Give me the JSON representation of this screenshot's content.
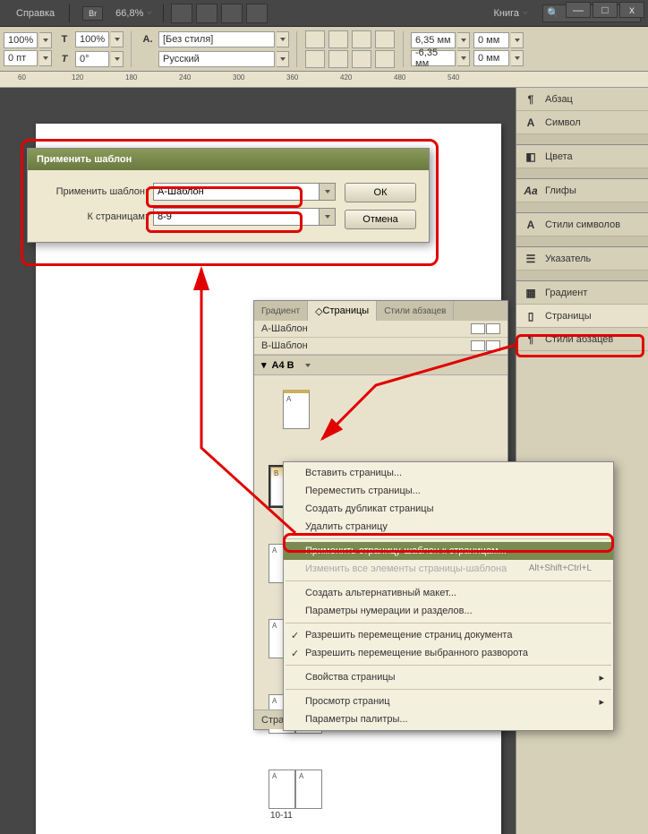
{
  "menubar": {
    "help": "Справка",
    "br_badge": "Br",
    "zoom": "66,8%",
    "book": "Книга"
  },
  "window_controls": {
    "min": "—",
    "max": "□",
    "close": "x"
  },
  "controlbar": {
    "percent1": "100%",
    "percent2": "100%",
    "leading": "0 пт",
    "t_icon": "T",
    "t_small": "T",
    "a_icon": "A.",
    "style_none": "[Без стиля]",
    "lang": "Русский",
    "rotation": "0°",
    "measure_top": "6,35 мм",
    "measure_bot": "-6,35 мм",
    "zero1": "0 мм",
    "zero2": "0 мм"
  },
  "ruler_vals": [
    "60",
    "120",
    "180",
    "240",
    "300",
    "360",
    "420",
    "480",
    "540"
  ],
  "right_panels": {
    "abzac": "Абзац",
    "symbol": "Символ",
    "cveta": "Цвета",
    "glyphs": "Глифы",
    "char_styles": "Стили символов",
    "pointer": "Указатель",
    "gradient": "Градиент",
    "pages": "Страницы",
    "para_styles": "Стили абзацев"
  },
  "dialog": {
    "title": "Применить шаблон",
    "label1": "Применить шаблон:",
    "value1": "А-Шаблон",
    "label2": "К страницам:",
    "value2": "8-9",
    "ok": "ОК",
    "cancel": "Отмена"
  },
  "pages_panel": {
    "tab1": "Градиент",
    "tab2": "Страницы",
    "tab3": "Стили абзацев",
    "master_a": "А-Шаблон",
    "master_b": "В-Шаблон",
    "section": "А4 В",
    "spread_1011": "10-11",
    "status": "Страниц 23, разворотов 12"
  },
  "context_menu": {
    "insert": "Вставить страницы...",
    "move": "Переместить страницы...",
    "duplicate": "Создать дубликат страницы",
    "delete": "Удалить страницу",
    "apply_master": "Применить страницу-шаблон к страницам...",
    "override": "Изменить все элементы страницы-шаблона",
    "override_sc": "Alt+Shift+Ctrl+L",
    "alt_layout": "Создать альтернативный макет...",
    "numbering": "Параметры нумерации и разделов...",
    "allow_move": "Разрешить перемещение страниц документа",
    "allow_spread": "Разрешить перемещение выбранного разворота",
    "page_props": "Свойства страницы",
    "view_pages": "Просмотр страниц",
    "palette_opts": "Параметры палитры..."
  }
}
